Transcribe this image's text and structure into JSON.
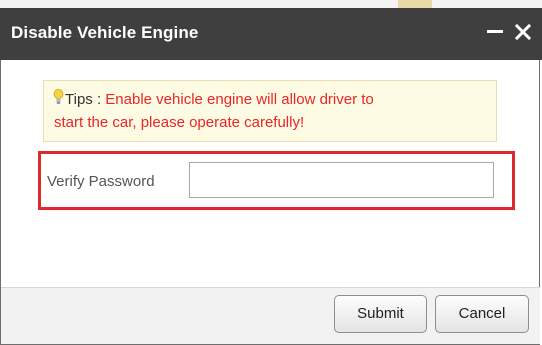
{
  "dialog": {
    "title": "Disable Vehicle Engine",
    "minimize_icon": "minimize-icon",
    "close_icon": "close-icon"
  },
  "tips": {
    "icon": "lightbulb-icon",
    "prefix": "Tips :",
    "message_line1": "Enable vehicle engine will allow driver to",
    "message_line2": "start the car, please operate carefully!"
  },
  "form": {
    "verify_label": "Verify Password",
    "password_value": ""
  },
  "buttons": {
    "submit_label": "Submit",
    "cancel_label": "Cancel"
  },
  "colors": {
    "titlebar": "#3f3f3f",
    "tip_text_red": "#e8262a",
    "highlight_border": "#e0282f",
    "tip_background": "#fdfbe3"
  }
}
